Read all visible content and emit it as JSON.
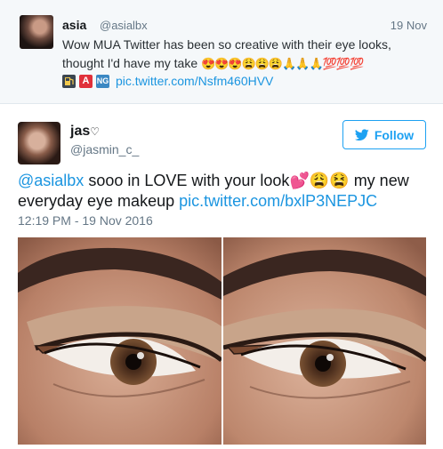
{
  "quoted": {
    "name": "asia",
    "handle": "@asialbx",
    "date": "19 Nov",
    "text": "Wow MUA Twitter has been so creative with their eye looks, thought I'd have my take",
    "emojis": "😍😍😍😩😩😩🙏🙏🙏💯💯💯",
    "icon_a": "A",
    "icon_ng": "NG",
    "link": "pic.twitter.com/Nsfm460HVV"
  },
  "tweet": {
    "name": "jas",
    "name_emoji": "♡",
    "handle": "@jasmin_c_",
    "follow_label": "Follow",
    "mention": "@asialbx",
    "text_part1": " sooo in LOVE with your look",
    "text_emojis": "💕😩😫",
    "text_part2": " my new everyday eye makeup ",
    "link": "pic.twitter.com/bxlP3NEPJC",
    "timestamp": "12:19 PM - 19 Nov 2016"
  },
  "colors": {
    "link_blue": "#1b95e0",
    "follow_blue": "#1da1f2",
    "muted_gray": "#657786",
    "quoted_bg": "#f5f8fa"
  },
  "icons": {
    "follow": "twitter-bird-icon",
    "fuel": "fuel-pump-icon"
  }
}
